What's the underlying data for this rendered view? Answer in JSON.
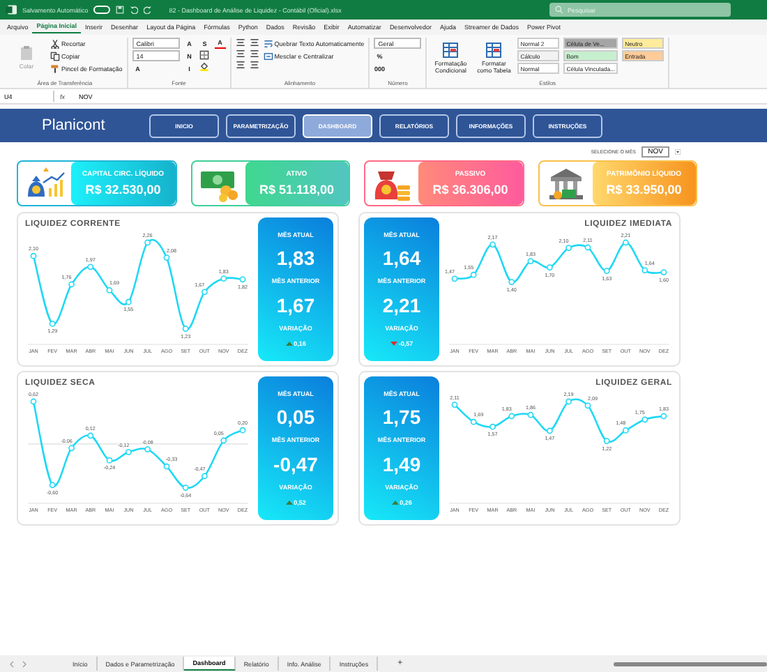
{
  "title_bar": {
    "autosave_label": "Salvamento Automático",
    "autosave_on": false,
    "file_title": "82 - Dashboard de Análise de Liquidez - Contábil (Oficial).xlsx",
    "search": {
      "placeholder": "Pesquisar"
    }
  },
  "menu_tabs": [
    {
      "label": "Arquivo",
      "selected": false
    },
    {
      "label": "Página Inicial",
      "selected": true
    },
    {
      "label": "Inserir",
      "selected": false
    },
    {
      "label": "Desenhar",
      "selected": false
    },
    {
      "label": "Layout da Página",
      "selected": false
    },
    {
      "label": "Fórmulas",
      "selected": false
    },
    {
      "label": "Python",
      "selected": false
    },
    {
      "label": "Dados",
      "selected": false
    },
    {
      "label": "Revisão",
      "selected": false
    },
    {
      "label": "Exibir",
      "selected": false
    },
    {
      "label": "Automatizar",
      "selected": false
    },
    {
      "label": "Desenvolvedor",
      "selected": false
    },
    {
      "label": "Ajuda",
      "selected": false
    },
    {
      "label": "Streamer de Dados",
      "selected": false
    },
    {
      "label": "Power Pivot",
      "selected": false
    }
  ],
  "ribbon_groups": [
    {
      "label": "Área de Transferência",
      "controls": [
        {
          "kind": "paste",
          "text": "Colar",
          "disabled": true
        },
        {
          "kind": "cut",
          "text": "Recortar"
        },
        {
          "kind": "copy",
          "text": "Copiar"
        },
        {
          "kind": "painter",
          "text": "Pincel de Formatação"
        }
      ]
    },
    {
      "label": "Fonte",
      "controls": [
        {
          "kind": "field",
          "text": "Calibri"
        },
        {
          "kind": "field",
          "text": "14"
        },
        {
          "kind": "letter",
          "text": "A"
        },
        {
          "kind": "letter",
          "text": "A"
        },
        {
          "kind": "letter",
          "text": "N"
        },
        {
          "kind": "letter",
          "text": "I"
        },
        {
          "kind": "letter",
          "text": "S"
        },
        {
          "kind": "border"
        },
        {
          "kind": "fill"
        },
        {
          "kind": "fontcolor",
          "text": "A"
        }
      ]
    },
    {
      "label": "Alinhamento",
      "controls": [
        {
          "kind": "lines"
        },
        {
          "kind": "lines"
        },
        {
          "kind": "lines"
        },
        {
          "kind": "lines"
        },
        {
          "kind": "lines"
        },
        {
          "kind": "lines"
        },
        {
          "kind": "wrap",
          "text": "Quebrar Texto Automaticamente"
        },
        {
          "kind": "merge",
          "text": "Mesclar e Centralizar"
        }
      ]
    },
    {
      "label": "Número",
      "controls": [
        {
          "kind": "field",
          "text": "Geral"
        },
        {
          "kind": "letter",
          "text": "%"
        },
        {
          "kind": "letter",
          "text": "000"
        }
      ]
    },
    {
      "label": "Estilos",
      "controls": [
        {
          "kind": "big",
          "text": "Formatação Condicional"
        },
        {
          "kind": "big",
          "text": "Formatar como Tabela"
        },
        {
          "kind": "style",
          "text": "Normal 2",
          "color": "#ffffff"
        },
        {
          "kind": "style",
          "text": "Cálculo",
          "color": "#f2f2f2"
        },
        {
          "kind": "style",
          "text": "Normal",
          "color": "#ffffff"
        },
        {
          "kind": "style",
          "text": "Célula de Ve...",
          "color": "#a5a5a5"
        },
        {
          "kind": "style",
          "text": "Bom",
          "color": "#c6efce"
        },
        {
          "kind": "style",
          "text": "Célula Vinculada...",
          "color": "#ffffff"
        },
        {
          "kind": "style",
          "text": "Neutro",
          "color": "#ffeb9c"
        },
        {
          "kind": "style",
          "text": "Entrada",
          "color": "#ffcc99"
        }
      ]
    }
  ],
  "formula_bar": {
    "cell": "U4",
    "fx": "fx",
    "value": "NOV"
  },
  "dashboard": {
    "logo": "Planicont",
    "nav": [
      {
        "label": "INICIO",
        "selected": false
      },
      {
        "label": "PARAMETRIZAÇÃO",
        "selected": false
      },
      {
        "label": "DASHBOARD",
        "selected": true
      },
      {
        "label": "RELATÓRIOS",
        "selected": false
      },
      {
        "label": "INFORMAÇÕES",
        "selected": false
      },
      {
        "label": "INSTRUÇÕES",
        "selected": false
      }
    ],
    "month_selector": {
      "label": "SELECIONE O MÊS",
      "value": "NOV"
    },
    "kpis": [
      {
        "kind": "capital",
        "title": "CAPITAL CIRC. LÍQUIDO",
        "value": "R$ 32.530,00",
        "color": "#1fb6d6"
      },
      {
        "kind": "asset",
        "title": "ATIVO",
        "value": "R$ 51.118,00",
        "color": "#3fcf9a"
      },
      {
        "kind": "liability",
        "title": "PASSIVO",
        "value": "R$ 36.306,00",
        "color": "#ff6b86"
      },
      {
        "kind": "equity",
        "title": "PATRIMÔNIO LÍQUIDO",
        "value": "R$ 33.950,00",
        "color": "#f9c04a"
      }
    ],
    "panels": [
      {
        "title": "LIQUIDEZ CORRENTE",
        "current_label": "MÊS ATUAL",
        "current_value": "1,83",
        "previous_label": "MÊS ANTERIOR",
        "previous_value": "1,67",
        "variation_label": "VARIAÇÃO",
        "variation": "0,16",
        "rising": true,
        "chart_data": {
          "type": "line",
          "categories": [
            "JAN",
            "FEV",
            "MAR",
            "ABR",
            "MAI",
            "JUN",
            "JUL",
            "AGO",
            "SET",
            "OUT",
            "NOV",
            "DEZ"
          ],
          "data_labels": "value_labels",
          "series": [
            {
              "color": "#1fd8f5",
              "marker": "circle",
              "values": [
                2.1,
                1.29,
                1.76,
                1.97,
                1.69,
                1.55,
                2.26,
                2.08,
                1.23,
                1.67,
                1.83,
                1.82
              ],
              "value_labels": [
                "2,10",
                "1,29",
                "1,76",
                "1,97",
                "1,69",
                "1,55",
                "2,26",
                "2,08",
                "1,23",
                "1,67",
                "1,83",
                "1,82"
              ]
            }
          ]
        }
      },
      {
        "title": "LIQUIDEZ IMEDIATA",
        "current_label": "MÊS ATUAL",
        "current_value": "1,64",
        "previous_label": "MÊS ANTERIOR",
        "previous_value": "2,21",
        "variation_label": "VARIAÇÃO",
        "variation": "-0,57",
        "rising": false,
        "chart_data": {
          "type": "line",
          "categories": [
            "JAN",
            "FEV",
            "MAR",
            "ABR",
            "MAI",
            "JUN",
            "JUL",
            "AGO",
            "SET",
            "OUT",
            "NOV",
            "DEZ"
          ],
          "data_labels": "value_labels",
          "series": [
            {
              "color": "#1fd8f5",
              "marker": "circle",
              "values": [
                1.47,
                1.55,
                2.17,
                1.4,
                1.83,
                1.7,
                2.1,
                2.11,
                1.63,
                2.21,
                1.64,
                1.6
              ],
              "value_labels": [
                "1,47",
                "1,55",
                "2,17",
                "1,40",
                "1,83",
                "1,70",
                "2,10",
                "2,11",
                "1,63",
                "2,21",
                "1,64",
                "1,60"
              ]
            }
          ]
        }
      },
      {
        "title": "LIQUIDEZ SECA",
        "current_label": "MÊS ATUAL",
        "current_value": "0,05",
        "previous_label": "MÊS ANTERIOR",
        "previous_value": "-0,47",
        "variation_label": "VARIAÇÃO",
        "variation": "0,52",
        "rising": true,
        "chart_data": {
          "type": "line",
          "categories": [
            "JAN",
            "FEV",
            "MAR",
            "ABR",
            "MAI",
            "JUN",
            "JUL",
            "AGO",
            "SET",
            "OUT",
            "NOV",
            "DEZ"
          ],
          "data_labels": "value_labels",
          "series": [
            {
              "color": "#1fd8f5",
              "marker": "circle",
              "values": [
                0.62,
                -0.6,
                -0.06,
                0.12,
                -0.24,
                -0.12,
                -0.08,
                -0.33,
                -0.64,
                -0.47,
                0.05,
                0.2
              ],
              "value_labels": [
                "0,62",
                "-0,60",
                "-0,06",
                "0,12",
                "-0,24",
                "-0,12",
                "-0,08",
                "-0,33",
                "-0,64",
                "-0,47",
                "0,05",
                "0,20"
              ]
            }
          ]
        }
      },
      {
        "title": "LIQUIDEZ GERAL",
        "current_label": "MÊS ATUAL",
        "current_value": "1,75",
        "previous_label": "MÊS ANTERIOR",
        "previous_value": "1,49",
        "variation_label": "VARIAÇÃO",
        "variation": "0,26",
        "rising": true,
        "chart_data": {
          "type": "line",
          "categories": [
            "JAN",
            "FEV",
            "MAR",
            "ABR",
            "MAI",
            "JUN",
            "JUL",
            "AGO",
            "SET",
            "OUT",
            "NOV",
            "DEZ"
          ],
          "data_labels": "value_labels",
          "series": [
            {
              "color": "#1fd8f5",
              "marker": "circle",
              "values": [
                2.11,
                1.69,
                1.57,
                1.83,
                1.86,
                1.47,
                2.19,
                2.09,
                1.22,
                1.48,
                1.75,
                1.83
              ],
              "value_labels": [
                "2,11",
                "1,69",
                "1,57",
                "1,83",
                "1,86",
                "1,47",
                "2,19",
                "2,09",
                "1,22",
                "1,48",
                "1,75",
                "1,83"
              ]
            }
          ]
        }
      }
    ]
  },
  "sheet_tabs": [
    {
      "label": "Início",
      "selected": false
    },
    {
      "label": "Dados e Parametrização",
      "selected": false
    },
    {
      "label": "Dashboard",
      "selected": true
    },
    {
      "label": "Relatório",
      "selected": false
    },
    {
      "label": "Info. Análise",
      "selected": false
    },
    {
      "label": "Instruções",
      "selected": false
    }
  ],
  "add_sheet": "+"
}
